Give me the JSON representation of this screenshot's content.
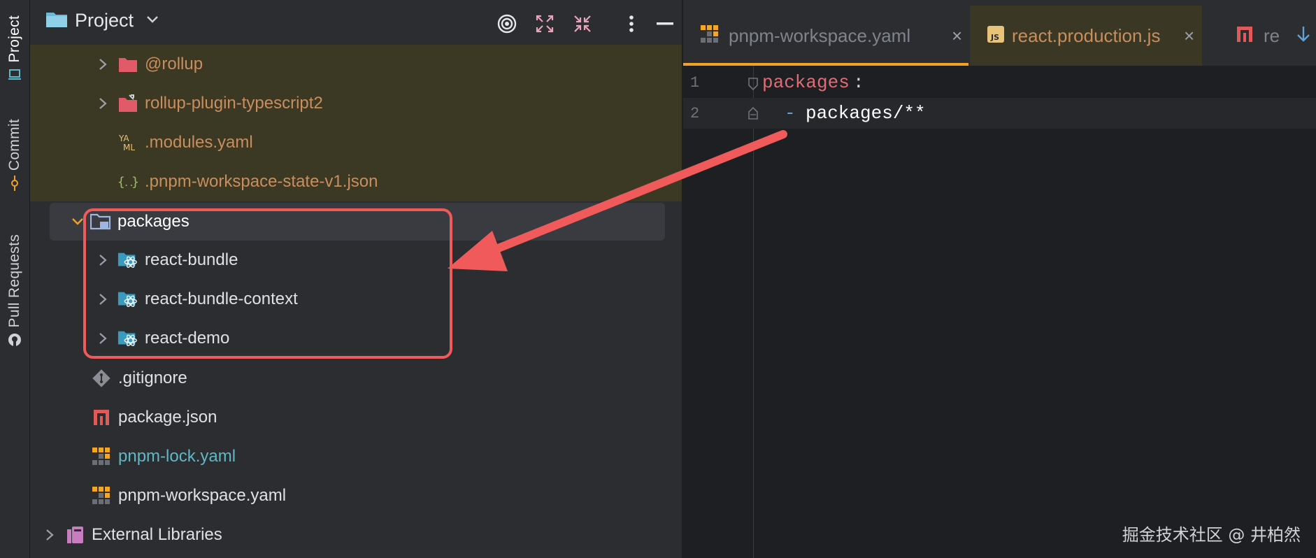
{
  "sidebar": {
    "tabs": [
      {
        "label": "Project",
        "icon": "laptop-icon",
        "active": true
      },
      {
        "label": "Commit",
        "icon": "commit-icon",
        "active": false
      },
      {
        "label": "Pull Requests",
        "icon": "github-icon",
        "active": false
      }
    ]
  },
  "project_panel": {
    "title": "Project",
    "header_icons": [
      "target-icon",
      "expand-icon",
      "collapse-icon",
      "more-icon",
      "minimize-icon"
    ],
    "tree": [
      {
        "label": "@rollup",
        "icon": "folder-icon",
        "expandable": true,
        "excluded": true
      },
      {
        "label": "rollup-plugin-typescript2",
        "icon": "folder-link-icon",
        "expandable": true,
        "excluded": true
      },
      {
        "label": ".modules.yaml",
        "icon": "yaml-icon",
        "expandable": false,
        "excluded": true
      },
      {
        "label": ".pnpm-workspace-state-v1.json",
        "icon": "json-icon",
        "expandable": false,
        "excluded": true
      },
      {
        "label": "packages",
        "icon": "module-folder-icon",
        "expandable": true,
        "expanded": true,
        "selected": true
      },
      {
        "label": "react-bundle",
        "icon": "react-folder-icon",
        "expandable": true
      },
      {
        "label": "react-bundle-context",
        "icon": "react-folder-icon",
        "expandable": true
      },
      {
        "label": "react-demo",
        "icon": "react-folder-icon",
        "expandable": true
      },
      {
        "label": ".gitignore",
        "icon": "git-icon",
        "expandable": false
      },
      {
        "label": "package.json",
        "icon": "npm-icon",
        "expandable": false
      },
      {
        "label": "pnpm-lock.yaml",
        "icon": "pnpm-icon",
        "expandable": false,
        "modified": true
      },
      {
        "label": "pnpm-workspace.yaml",
        "icon": "pnpm-icon",
        "expandable": false
      },
      {
        "label": "External Libraries",
        "icon": "library-icon",
        "expandable": true
      }
    ]
  },
  "editor": {
    "tabs": [
      {
        "label": "pnpm-workspace.yaml",
        "icon": "pnpm-icon",
        "active": true
      },
      {
        "label": "react.production.js",
        "icon": "js-icon",
        "active": false
      },
      {
        "label": "re",
        "icon": "npm-icon",
        "active": false
      }
    ],
    "lines": [
      {
        "num": "1",
        "key": "packages",
        "colon": ":"
      },
      {
        "num": "2",
        "dash": "-",
        "value": "packages/**"
      }
    ]
  },
  "watermark": "掘金技术社区 @ 井柏然",
  "colors": {
    "accent": "#f0a227",
    "highlight": "#f05a5a",
    "yaml_key": "#e06c75",
    "modified_file": "#5fb8c5"
  }
}
